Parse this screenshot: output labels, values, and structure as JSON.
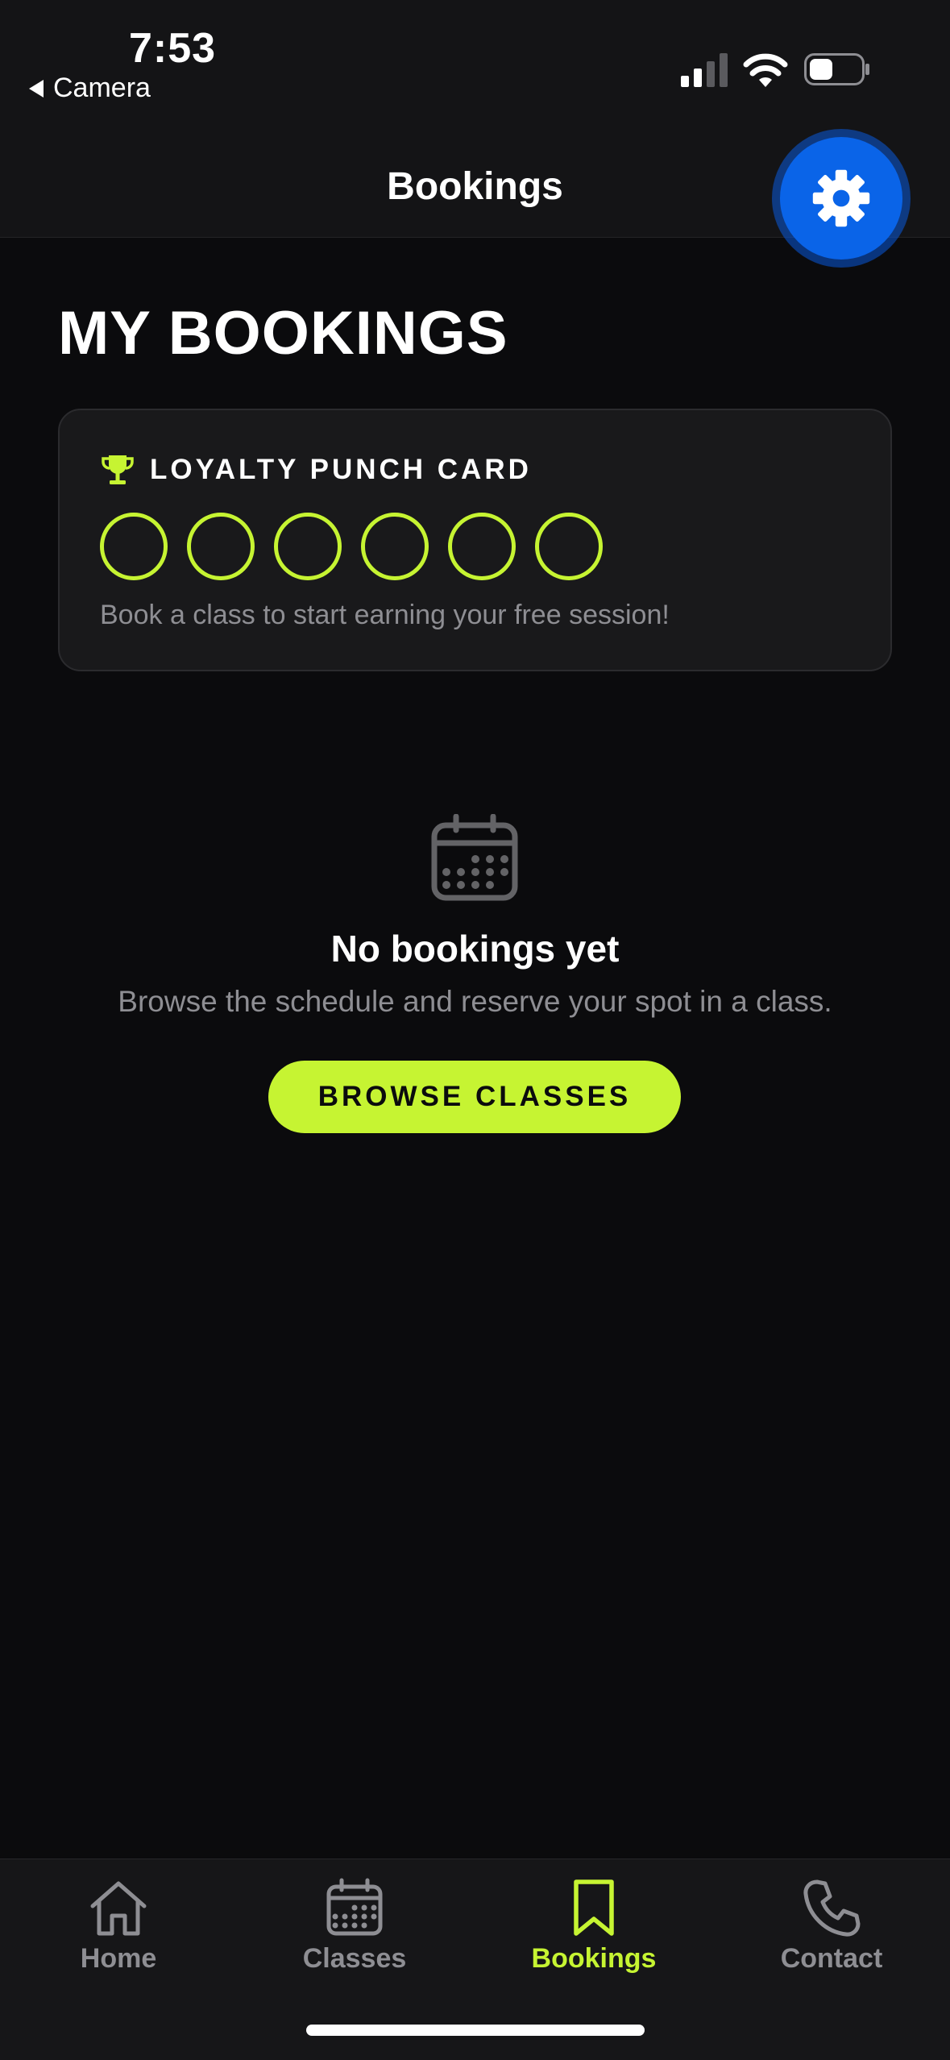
{
  "status_bar": {
    "time": "7:53",
    "back_app": "Camera"
  },
  "header": {
    "title": "Bookings"
  },
  "page": {
    "title": "MY BOOKINGS"
  },
  "loyalty": {
    "title": "LOYALTY PUNCH CARD",
    "punches_total": 6,
    "punches_filled": 0,
    "hint": "Book a class to start earning your free session!"
  },
  "empty_state": {
    "title": "No bookings yet",
    "text": "Browse the schedule and reserve your spot in a class.",
    "button": "BROWSE CLASSES"
  },
  "tabs": [
    {
      "label": "Home",
      "icon": "home-icon"
    },
    {
      "label": "Classes",
      "icon": "calendar-icon"
    },
    {
      "label": "Bookings",
      "icon": "bookmark-icon",
      "active": true
    },
    {
      "label": "Contact",
      "icon": "phone-icon"
    }
  ],
  "colors": {
    "accent": "#c6f432",
    "fab": "#0a64e8",
    "background": "#0b0b0d",
    "card": "#19191b",
    "muted": "#8e8e93"
  }
}
